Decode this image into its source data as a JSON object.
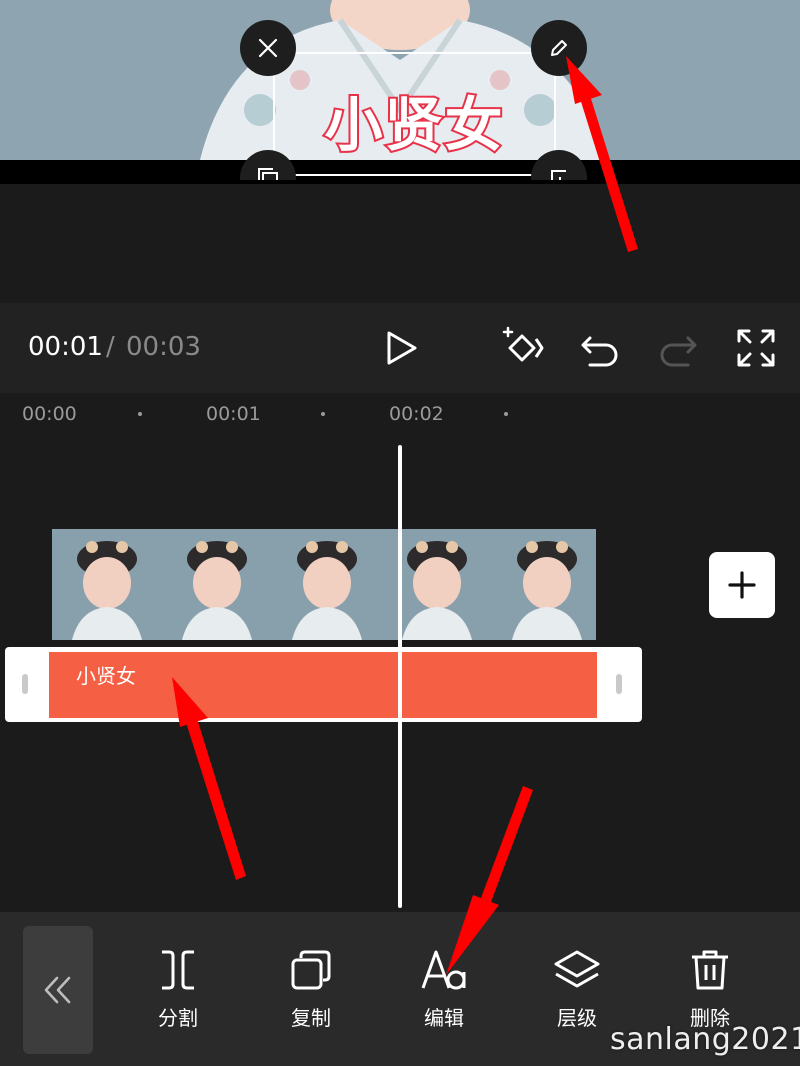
{
  "preview": {
    "overlay_text": "小贤女"
  },
  "player": {
    "current_time": "00:01",
    "separator": "/",
    "total_time": "00:03"
  },
  "ruler": {
    "marks": [
      "00:00",
      "00:01",
      "00:02"
    ]
  },
  "timeline": {
    "text_clip_label": "小贤女"
  },
  "toolbar": {
    "items": [
      {
        "label": "分割",
        "icon": "split-icon"
      },
      {
        "label": "复制",
        "icon": "copy-icon"
      },
      {
        "label": "编辑",
        "icon": "text-edit-icon"
      },
      {
        "label": "层级",
        "icon": "layers-icon"
      },
      {
        "label": "删除",
        "icon": "trash-icon"
      }
    ]
  },
  "watermark": "sanlang2021",
  "colors": {
    "accent_clip": "#f55f44",
    "annotation_arrow": "#ff0000",
    "text_stroke": "#e8334a"
  }
}
